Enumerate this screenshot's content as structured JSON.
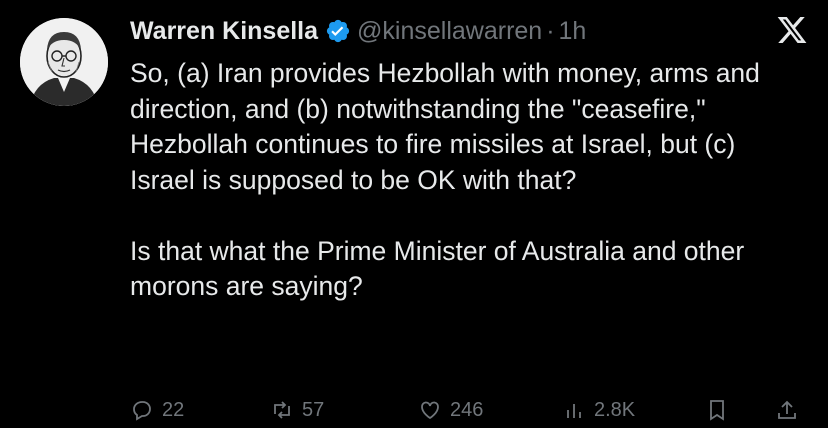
{
  "author": {
    "display_name": "Warren Kinsella",
    "handle": "@kinsellawarren",
    "separator": "·",
    "time": "1h",
    "verified": true
  },
  "tweet": {
    "text": "So, (a) Iran provides Hezbollah with money, arms and direction, and (b) notwithstanding the \"ceasefire,\" Hezbollah continues to fire missiles at Israel, but (c)  Israel is supposed to be OK with that?\n\nIs that what the Prime Minister of Australia and other morons are saying?"
  },
  "actions": {
    "replies": "22",
    "reposts": "57",
    "likes": "246",
    "views": "2.8K"
  },
  "colors": {
    "background": "#000000",
    "text": "#e7e9ea",
    "muted": "#71767b",
    "verified": "#1d9bf0"
  },
  "icons": [
    "x-logo-icon",
    "verified-badge-icon",
    "reply-icon",
    "repost-icon",
    "like-icon",
    "views-icon",
    "share-icon"
  ]
}
